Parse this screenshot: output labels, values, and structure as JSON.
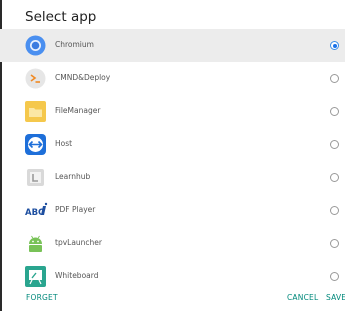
{
  "dialog": {
    "title": "Select app",
    "apps": [
      {
        "label": "Chromium",
        "icon": "chromium-icon",
        "selected": true
      },
      {
        "label": "CMND&Deploy",
        "icon": "cmnd-deploy-icon",
        "selected": false
      },
      {
        "label": "FileManager",
        "icon": "folder-icon",
        "selected": false
      },
      {
        "label": "Host",
        "icon": "host-icon",
        "selected": false
      },
      {
        "label": "Learnhub",
        "icon": "learnhub-icon",
        "selected": false
      },
      {
        "label": "PDF Player",
        "icon": "abc-pdf-icon",
        "icon_text": "ABC",
        "selected": false
      },
      {
        "label": "tpvLauncher",
        "icon": "android-icon",
        "selected": false
      },
      {
        "label": "Whiteboard",
        "icon": "whiteboard-icon",
        "selected": false
      }
    ],
    "buttons": {
      "forget": "FORGET",
      "cancel": "CANCEL",
      "save": "SAVE"
    }
  },
  "colors": {
    "accent": "#00897b",
    "radio_selected": "#1a73e8",
    "selected_row": "#ececec"
  }
}
